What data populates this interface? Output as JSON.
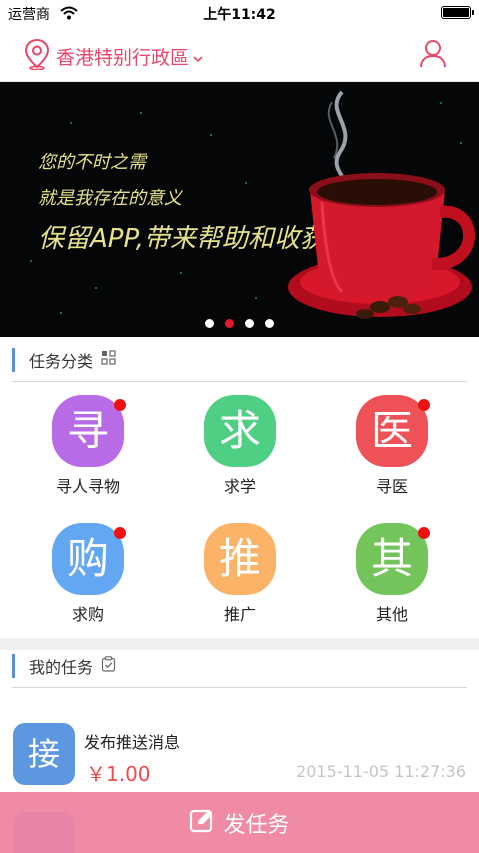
{
  "status_bar": {
    "carrier": "运营商",
    "time": "上午11:42"
  },
  "nav": {
    "location": "香港特别行政區"
  },
  "banner": {
    "line1": "您的不时之需",
    "line2": "就是我存在的意义",
    "line3": "保留APP,带来帮助和收获",
    "dots": [
      false,
      true,
      false,
      false
    ]
  },
  "categories_section": {
    "title": "任务分类"
  },
  "categories": [
    {
      "glyph": "寻",
      "label": "寻人寻物",
      "color": "#b86be6",
      "badge": true
    },
    {
      "glyph": "求",
      "label": "求学",
      "color": "#4fcf84",
      "badge": false
    },
    {
      "glyph": "医",
      "label": "寻医",
      "color": "#ee5256",
      "badge": true
    },
    {
      "glyph": "购",
      "label": "求购",
      "color": "#63a7f2",
      "badge": true
    },
    {
      "glyph": "推",
      "label": "推广",
      "color": "#fbb367",
      "badge": false
    },
    {
      "glyph": "其",
      "label": "其他",
      "color": "#74c45c",
      "badge": true
    }
  ],
  "tasks_section": {
    "title": "我的任务"
  },
  "task": {
    "badge": "接",
    "title": "发布推送消息",
    "price": "￥1.00",
    "time": "2015-11-05 11:27:36"
  },
  "publish": {
    "label": "发任务"
  },
  "colors": {
    "accent": "#e8466a",
    "active_dot": "#e8162e",
    "publish_bg": "#f08ba6",
    "section_bar": "#5b8fd6"
  }
}
